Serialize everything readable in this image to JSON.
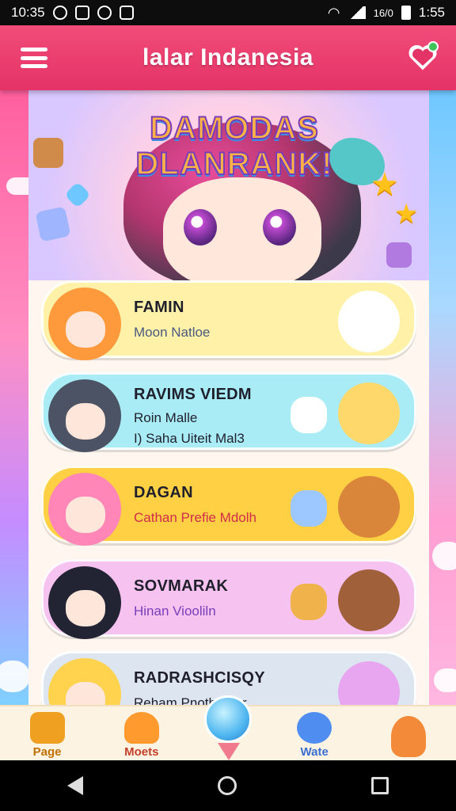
{
  "status_bar": {
    "time_left": "10:35",
    "time_right": "1:55",
    "signal_text": "16/0",
    "icons": [
      "pause-icon",
      "image-icon",
      "sync-icon",
      "photo-icon",
      "wifi-icon",
      "signal-icon",
      "battery-icon"
    ]
  },
  "app_bar": {
    "title": "lalar Indanesia",
    "menu_icon": "hamburger-menu-icon",
    "action_icon": "heart-notification-icon",
    "accent_color": "#e43366"
  },
  "banner": {
    "title": "DAMODAS DLANRANK!"
  },
  "list": [
    {
      "name": "FAMIN",
      "sub": "Moon Natloe",
      "sub2": "",
      "sub_color": "#4a5a80",
      "bg": "#fff1a8",
      "avatar_color": "#ff9a3c",
      "mascot_color": "#ffffff"
    },
    {
      "name": "RAVIMS VIEDM",
      "sub": "Roin Malle",
      "sub2": "I) Saha Uiteit Mal3",
      "sub_color": "#1f1f2c",
      "bg": "#a9ecf6",
      "avatar_color": "#4b5364",
      "mascot_color": "#ffd86b"
    },
    {
      "name": "DAGAN",
      "sub": "Cathan Prefie Mdolh",
      "sub2": "",
      "sub_color": "#d12d4a",
      "bg": "#ffd044",
      "avatar_color": "#ff86b6",
      "mascot_color": "#d9853a"
    },
    {
      "name": "SOVMARAK",
      "sub": "Hinan Viooliln",
      "sub2": "",
      "sub_color": "#7a3db8",
      "bg": "#f6c2f0",
      "avatar_color": "#232433",
      "mascot_color": "#a0603a"
    },
    {
      "name": "RADRASHCISQY",
      "sub": "Reham Pnothnfhar",
      "sub2": "",
      "sub_color": "#1f1f2c",
      "bg": "#dde6f0",
      "avatar_color": "#ffd34d",
      "mascot_color": "#e7a6ef"
    }
  ],
  "bottom_nav": [
    {
      "label": "Page",
      "icon": "home-icon",
      "color": "#f0a020",
      "label_color": "#c07000"
    },
    {
      "label": "Moets",
      "icon": "heart-icon",
      "color": "#ff9a2e",
      "label_color": "#c4402a"
    },
    {
      "label": "Wate",
      "icon": "star-icon",
      "color": "#4f8ef0",
      "label_color": "#3a6fd0"
    },
    {
      "label": "",
      "icon": "mascot-icon",
      "color": "#f28a3a",
      "label_color": "#333333"
    }
  ],
  "center_button_icon": "balloon-icon",
  "system_nav": {
    "back": "back-icon",
    "home": "home-circle-icon",
    "recent": "recent-apps-icon"
  }
}
